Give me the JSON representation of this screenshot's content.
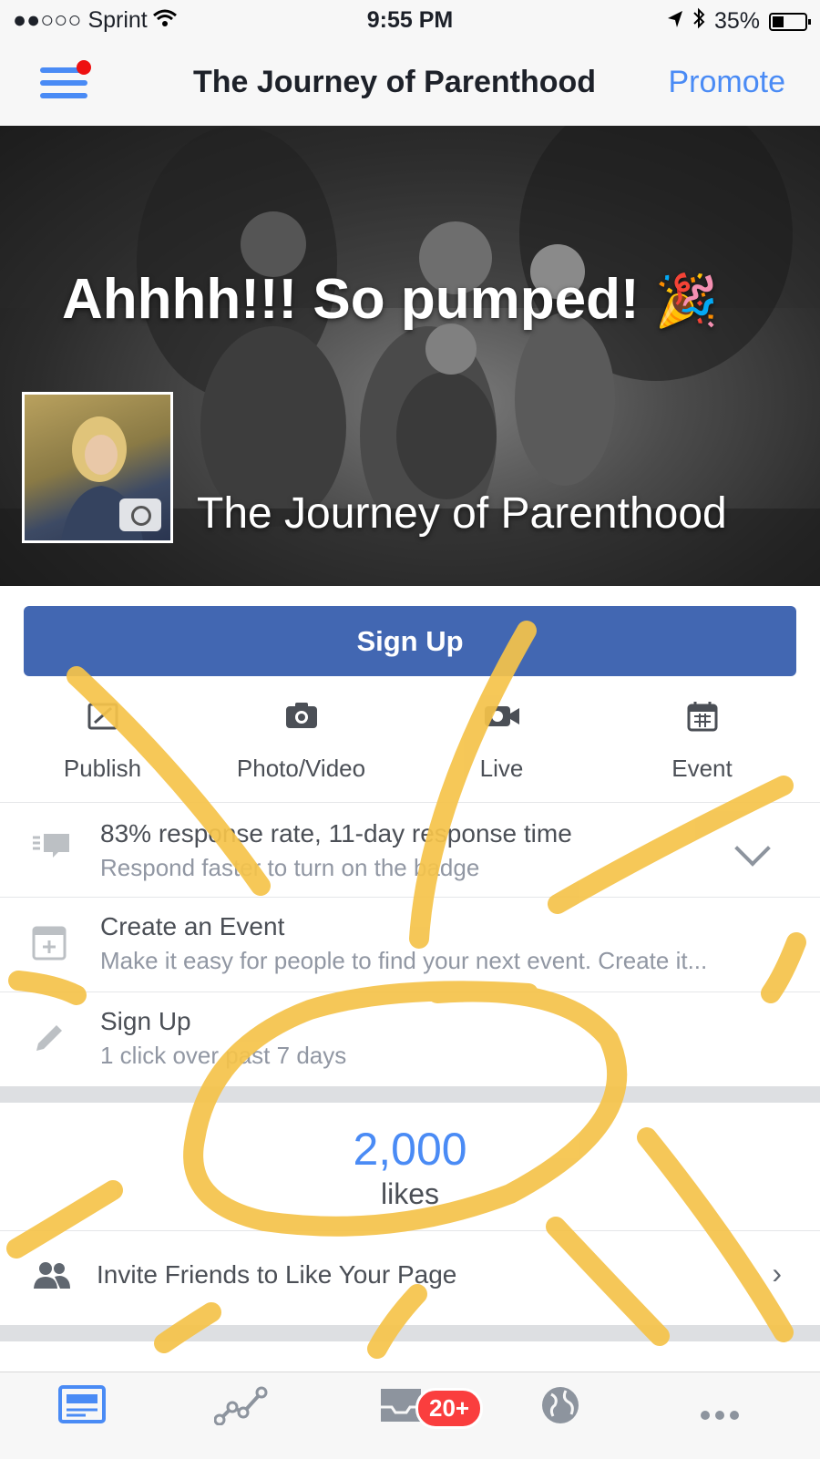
{
  "status_bar": {
    "carrier": "●●○○○ Sprint",
    "time": "9:55 PM",
    "battery_percent": "35%",
    "battery_level": 0.35
  },
  "navbar": {
    "title": "The Journey of Parenthood",
    "promote_label": "Promote"
  },
  "cover": {
    "caption": "Ahhhh!!! So pumped!",
    "caption_emoji": "🎉",
    "page_name": "The Journey of Parenthood"
  },
  "cta": {
    "label": "Sign Up",
    "color": "#4267b2"
  },
  "actions": [
    {
      "label": "Publish",
      "icon": "publish-icon"
    },
    {
      "label": "Photo/Video",
      "icon": "camera-icon"
    },
    {
      "label": "Live",
      "icon": "video-icon"
    },
    {
      "label": "Event",
      "icon": "calendar-icon"
    }
  ],
  "rows": [
    {
      "title": "83% response rate, 11-day response time",
      "sub": "Respond faster to turn on the badge",
      "icon": "chat-icon"
    },
    {
      "title": "Create an Event",
      "sub": "Make it easy for people to find your next event. Create it...",
      "icon": "calendar-plus-icon"
    },
    {
      "title": "Sign Up",
      "sub": "1 click over past 7 days",
      "icon": "pencil-icon"
    }
  ],
  "likes": {
    "count": "2,000",
    "label": "likes"
  },
  "invite": {
    "label": "Invite Friends to Like Your Page",
    "arrow": "›"
  },
  "tabbar": {
    "notifications_badge": "20+",
    "accent": "#4a8bf5"
  },
  "annotation_color": "#f5c34a"
}
